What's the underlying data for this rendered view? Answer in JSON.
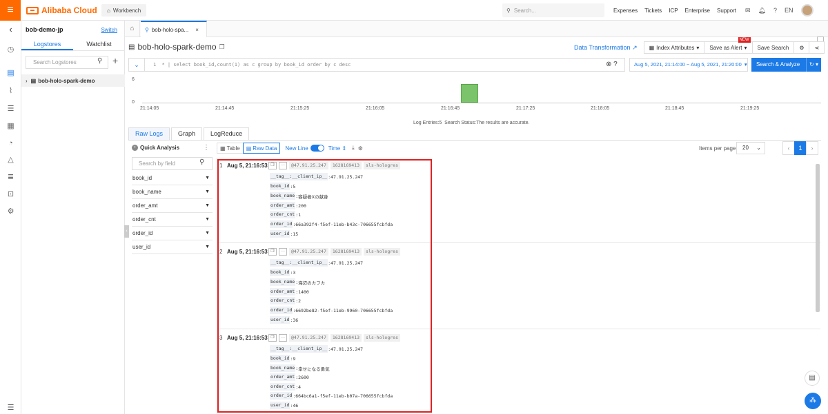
{
  "topbar": {
    "logo_text": "Alibaba Cloud",
    "workbench": "Workbench",
    "search_placeholder": "Search...",
    "links": [
      "Expenses",
      "Tickets",
      "ICP",
      "Enterprise",
      "Support"
    ],
    "lang": "EN",
    "brand_color": "#ff6a00"
  },
  "left_panel": {
    "project": "bob-demo-jp",
    "switch_label": "Switch",
    "tabs": [
      "Logstores",
      "Watchlist"
    ],
    "search_placeholder": "Search Logstores",
    "logstore": "bob-holo-spark-demo"
  },
  "tabbar": {
    "file_tab": "bob-holo-spa..."
  },
  "header": {
    "logstore_title": "bob-holo-spark-demo",
    "data_transformation": "Data Transformation",
    "index_attributes": "Index Attributes",
    "save_as_alert": "Save as Alert",
    "new_badge": "NEW",
    "save_search": "Save Search"
  },
  "query": {
    "text": "* | select book_id,count(1) as c group by book_id order by c desc",
    "line_no": "1",
    "time_range": "Aug 5, 2021, 21:14:00 ~ Aug 5, 2021, 21:20:00",
    "search_button": "Search & Analyze"
  },
  "histogram": {
    "y_max": "6",
    "y_min": "0",
    "x_ticks": [
      "21:14:05",
      "21:14:45",
      "21:15:25",
      "21:16:05",
      "21:16:45",
      "21:17:25",
      "21:18:05",
      "21:18:45",
      "21:19:25"
    ],
    "status_label": "Log Entries:",
    "log_entries": "5",
    "search_status_label": "Search Status:",
    "search_status": "The results are accurate."
  },
  "result_tabs": [
    "Raw Logs",
    "Graph",
    "LogReduce"
  ],
  "quick_analysis": {
    "title": "Quick Analysis",
    "search_placeholder": "Search by field",
    "fields": [
      "book_id",
      "book_name",
      "order_amt",
      "order_cnt",
      "order_id",
      "user_id"
    ]
  },
  "view_toolbar": {
    "table": "Table",
    "raw_data": "Raw Data",
    "new_line": "New Line",
    "time": "Time",
    "items_per_page_label": "Items per page:",
    "items_per_page": "20",
    "current_page": "1"
  },
  "logs": [
    {
      "num": "1",
      "time": "Aug 5, 21:16:53",
      "ip": "47.91.25.247",
      "ts": "1628169413",
      "source": "sls-hologres",
      "fields": [
        {
          "k": "__tag__:__client_ip__",
          "v": "47.91.25.247"
        },
        {
          "k": "book_id",
          "v": "5"
        },
        {
          "k": "book_name",
          "v": "容疑者Ⅹの献身"
        },
        {
          "k": "order_amt",
          "v": "200"
        },
        {
          "k": "order_cnt",
          "v": "1"
        },
        {
          "k": "order_id",
          "v": "66a392f4-f5ef-11eb-b43c-706655fcbfda"
        },
        {
          "k": "user_id",
          "v": "15"
        }
      ]
    },
    {
      "num": "2",
      "time": "Aug 5, 21:16:53",
      "ip": "47.91.25.247",
      "ts": "1628169413",
      "source": "sls-hologres",
      "fields": [
        {
          "k": "__tag__:__client_ip__",
          "v": "47.91.25.247"
        },
        {
          "k": "book_id",
          "v": "3"
        },
        {
          "k": "book_name",
          "v": "海辺のカフカ"
        },
        {
          "k": "order_amt",
          "v": "1400"
        },
        {
          "k": "order_cnt",
          "v": "2"
        },
        {
          "k": "order_id",
          "v": "6692be82-f5ef-11eb-9960-706655fcbfda"
        },
        {
          "k": "user_id",
          "v": "36"
        }
      ]
    },
    {
      "num": "3",
      "time": "Aug 5, 21:16:53",
      "ip": "47.91.25.247",
      "ts": "1628169413",
      "source": "sls-hologres",
      "fields": [
        {
          "k": "__tag__:__client_ip__",
          "v": "47.91.25.247"
        },
        {
          "k": "book_id",
          "v": "9"
        },
        {
          "k": "book_name",
          "v": "幸せになる勇気"
        },
        {
          "k": "order_amt",
          "v": "2600"
        },
        {
          "k": "order_cnt",
          "v": "4"
        },
        {
          "k": "order_id",
          "v": "664bc6a1-f5ef-11eb-b07a-706655fcbfda"
        },
        {
          "k": "user_id",
          "v": "46"
        }
      ]
    }
  ]
}
